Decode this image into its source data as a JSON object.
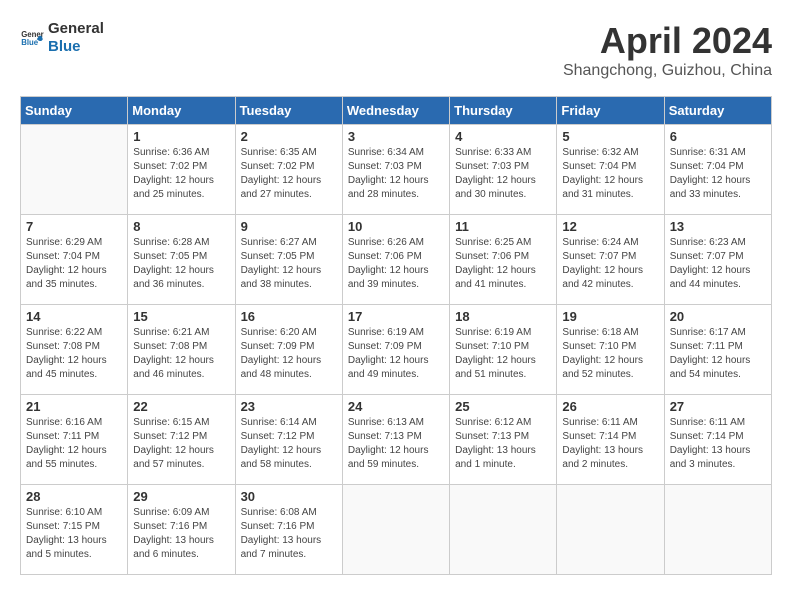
{
  "header": {
    "logo_general": "General",
    "logo_blue": "Blue",
    "month": "April 2024",
    "location": "Shangchong, Guizhou, China"
  },
  "weekdays": [
    "Sunday",
    "Monday",
    "Tuesday",
    "Wednesday",
    "Thursday",
    "Friday",
    "Saturday"
  ],
  "weeks": [
    [
      {
        "day": "",
        "info": ""
      },
      {
        "day": "1",
        "info": "Sunrise: 6:36 AM\nSunset: 7:02 PM\nDaylight: 12 hours\nand 25 minutes."
      },
      {
        "day": "2",
        "info": "Sunrise: 6:35 AM\nSunset: 7:02 PM\nDaylight: 12 hours\nand 27 minutes."
      },
      {
        "day": "3",
        "info": "Sunrise: 6:34 AM\nSunset: 7:03 PM\nDaylight: 12 hours\nand 28 minutes."
      },
      {
        "day": "4",
        "info": "Sunrise: 6:33 AM\nSunset: 7:03 PM\nDaylight: 12 hours\nand 30 minutes."
      },
      {
        "day": "5",
        "info": "Sunrise: 6:32 AM\nSunset: 7:04 PM\nDaylight: 12 hours\nand 31 minutes."
      },
      {
        "day": "6",
        "info": "Sunrise: 6:31 AM\nSunset: 7:04 PM\nDaylight: 12 hours\nand 33 minutes."
      }
    ],
    [
      {
        "day": "7",
        "info": "Sunrise: 6:29 AM\nSunset: 7:04 PM\nDaylight: 12 hours\nand 35 minutes."
      },
      {
        "day": "8",
        "info": "Sunrise: 6:28 AM\nSunset: 7:05 PM\nDaylight: 12 hours\nand 36 minutes."
      },
      {
        "day": "9",
        "info": "Sunrise: 6:27 AM\nSunset: 7:05 PM\nDaylight: 12 hours\nand 38 minutes."
      },
      {
        "day": "10",
        "info": "Sunrise: 6:26 AM\nSunset: 7:06 PM\nDaylight: 12 hours\nand 39 minutes."
      },
      {
        "day": "11",
        "info": "Sunrise: 6:25 AM\nSunset: 7:06 PM\nDaylight: 12 hours\nand 41 minutes."
      },
      {
        "day": "12",
        "info": "Sunrise: 6:24 AM\nSunset: 7:07 PM\nDaylight: 12 hours\nand 42 minutes."
      },
      {
        "day": "13",
        "info": "Sunrise: 6:23 AM\nSunset: 7:07 PM\nDaylight: 12 hours\nand 44 minutes."
      }
    ],
    [
      {
        "day": "14",
        "info": "Sunrise: 6:22 AM\nSunset: 7:08 PM\nDaylight: 12 hours\nand 45 minutes."
      },
      {
        "day": "15",
        "info": "Sunrise: 6:21 AM\nSunset: 7:08 PM\nDaylight: 12 hours\nand 46 minutes."
      },
      {
        "day": "16",
        "info": "Sunrise: 6:20 AM\nSunset: 7:09 PM\nDaylight: 12 hours\nand 48 minutes."
      },
      {
        "day": "17",
        "info": "Sunrise: 6:19 AM\nSunset: 7:09 PM\nDaylight: 12 hours\nand 49 minutes."
      },
      {
        "day": "18",
        "info": "Sunrise: 6:19 AM\nSunset: 7:10 PM\nDaylight: 12 hours\nand 51 minutes."
      },
      {
        "day": "19",
        "info": "Sunrise: 6:18 AM\nSunset: 7:10 PM\nDaylight: 12 hours\nand 52 minutes."
      },
      {
        "day": "20",
        "info": "Sunrise: 6:17 AM\nSunset: 7:11 PM\nDaylight: 12 hours\nand 54 minutes."
      }
    ],
    [
      {
        "day": "21",
        "info": "Sunrise: 6:16 AM\nSunset: 7:11 PM\nDaylight: 12 hours\nand 55 minutes."
      },
      {
        "day": "22",
        "info": "Sunrise: 6:15 AM\nSunset: 7:12 PM\nDaylight: 12 hours\nand 57 minutes."
      },
      {
        "day": "23",
        "info": "Sunrise: 6:14 AM\nSunset: 7:12 PM\nDaylight: 12 hours\nand 58 minutes."
      },
      {
        "day": "24",
        "info": "Sunrise: 6:13 AM\nSunset: 7:13 PM\nDaylight: 12 hours\nand 59 minutes."
      },
      {
        "day": "25",
        "info": "Sunrise: 6:12 AM\nSunset: 7:13 PM\nDaylight: 13 hours\nand 1 minute."
      },
      {
        "day": "26",
        "info": "Sunrise: 6:11 AM\nSunset: 7:14 PM\nDaylight: 13 hours\nand 2 minutes."
      },
      {
        "day": "27",
        "info": "Sunrise: 6:11 AM\nSunset: 7:14 PM\nDaylight: 13 hours\nand 3 minutes."
      }
    ],
    [
      {
        "day": "28",
        "info": "Sunrise: 6:10 AM\nSunset: 7:15 PM\nDaylight: 13 hours\nand 5 minutes."
      },
      {
        "day": "29",
        "info": "Sunrise: 6:09 AM\nSunset: 7:16 PM\nDaylight: 13 hours\nand 6 minutes."
      },
      {
        "day": "30",
        "info": "Sunrise: 6:08 AM\nSunset: 7:16 PM\nDaylight: 13 hours\nand 7 minutes."
      },
      {
        "day": "",
        "info": ""
      },
      {
        "day": "",
        "info": ""
      },
      {
        "day": "",
        "info": ""
      },
      {
        "day": "",
        "info": ""
      }
    ]
  ]
}
